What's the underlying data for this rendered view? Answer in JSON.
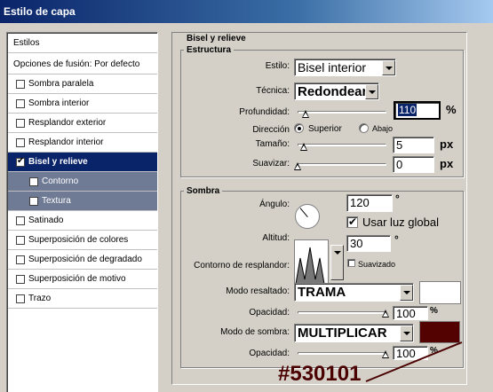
{
  "window": {
    "title": "Estilo de capa"
  },
  "left": {
    "header": "Estilos",
    "blend_options": "Opciones de fusión: Por defecto",
    "items": [
      {
        "label": "Sombra paralela",
        "checked": false
      },
      {
        "label": "Sombra interior",
        "checked": false
      },
      {
        "label": "Resplandor exterior",
        "checked": false
      },
      {
        "label": "Resplandor interior",
        "checked": false
      },
      {
        "label": "Bisel y relieve",
        "checked": true,
        "selected": true
      },
      {
        "label": "Contorno",
        "checked": false,
        "sub": true
      },
      {
        "label": "Textura",
        "checked": false,
        "sub": true
      },
      {
        "label": "Satinado",
        "checked": false
      },
      {
        "label": "Superposición de colores",
        "checked": false
      },
      {
        "label": "Superposición de degradado",
        "checked": false
      },
      {
        "label": "Superposición de motivo",
        "checked": false
      },
      {
        "label": "Trazo",
        "checked": false
      }
    ]
  },
  "bevel": {
    "title": "Bisel y relieve",
    "structure": {
      "title": "Estructura",
      "style_label": "Estilo:",
      "style_value": "Bisel interior",
      "technique_label": "Técnica:",
      "technique_value": "Redondear",
      "depth_label": "Profundidad:",
      "depth_value": "110",
      "depth_unit": "%",
      "direction_label": "Dirección",
      "direction_up": "Superior",
      "direction_down": "Abajo",
      "size_label": "Tamaño:",
      "size_value": "5",
      "size_unit": "px",
      "soften_label": "Suavizar:",
      "soften_value": "0",
      "soften_unit": "px"
    },
    "shading": {
      "title": "Sombra",
      "angle_label": "Ángulo:",
      "angle_value": "120",
      "degree": "°",
      "global_light_label": "Usar luz global",
      "altitude_label": "Altitud:",
      "altitude_value": "30",
      "gloss_label": "Contorno de resplandor:",
      "antialias_label": "Suavizado",
      "highlight_label": "Modo resaltado:",
      "highlight_mode": "TRAMA",
      "highlight_color": "#ffffff",
      "highlight_opacity_label": "Opacidad:",
      "highlight_opacity": "100",
      "shadow_label": "Modo de sombra:",
      "shadow_mode": "MULTIPLICAR",
      "shadow_color": "#530101",
      "shadow_opacity_label": "Opacidad:",
      "shadow_opacity": "100",
      "opacity_unit": "%"
    }
  },
  "annotation": {
    "text": "#530101",
    "color": "#4a0000"
  }
}
